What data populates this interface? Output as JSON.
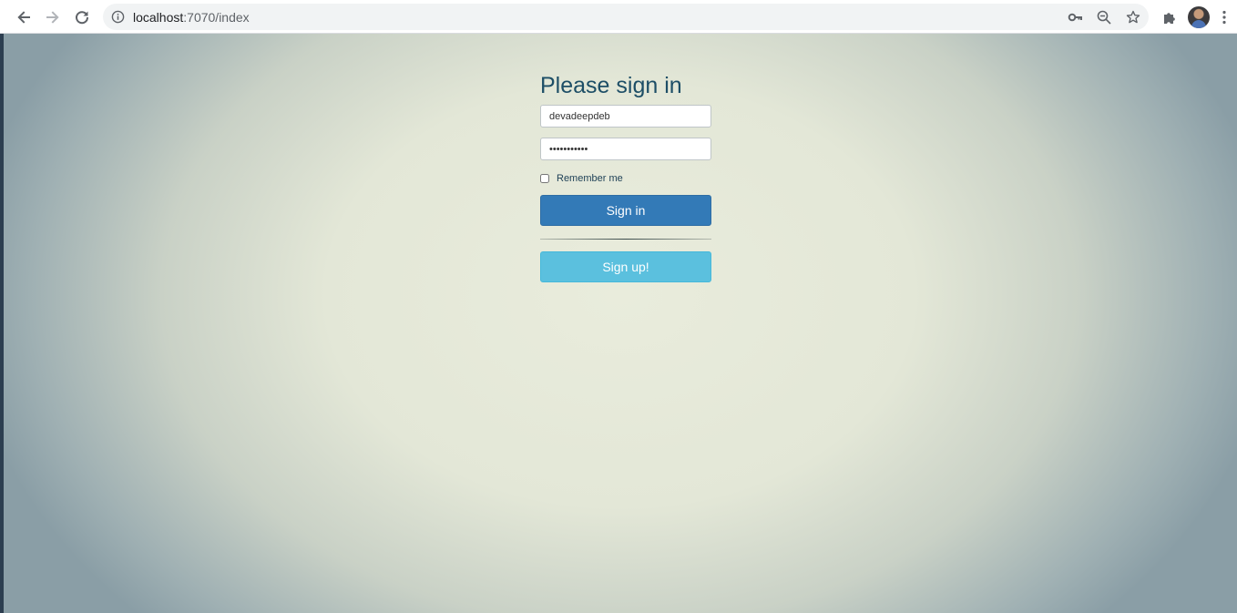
{
  "browser": {
    "url_host": "localhost",
    "url_rest": ":7070/index",
    "back_icon": "arrow-left-icon",
    "forward_icon": "arrow-right-icon",
    "reload_icon": "reload-icon",
    "info_icon": "info-icon",
    "key_icon": "key-icon",
    "zoom_icon": "zoom-out-icon",
    "star_icon": "star-icon",
    "extensions_icon": "puzzle-icon",
    "menu_icon": "kebab-menu-icon"
  },
  "signin": {
    "heading": "Please sign in",
    "username_value": "devadeepdeb",
    "password_value": "•••••••••••",
    "remember_label": "Remember me",
    "remember_checked": false,
    "signin_label": "Sign in",
    "signup_label": "Sign up!"
  },
  "colors": {
    "primary": "#337ab7",
    "info": "#5bc0de",
    "heading": "#1d4e66"
  }
}
